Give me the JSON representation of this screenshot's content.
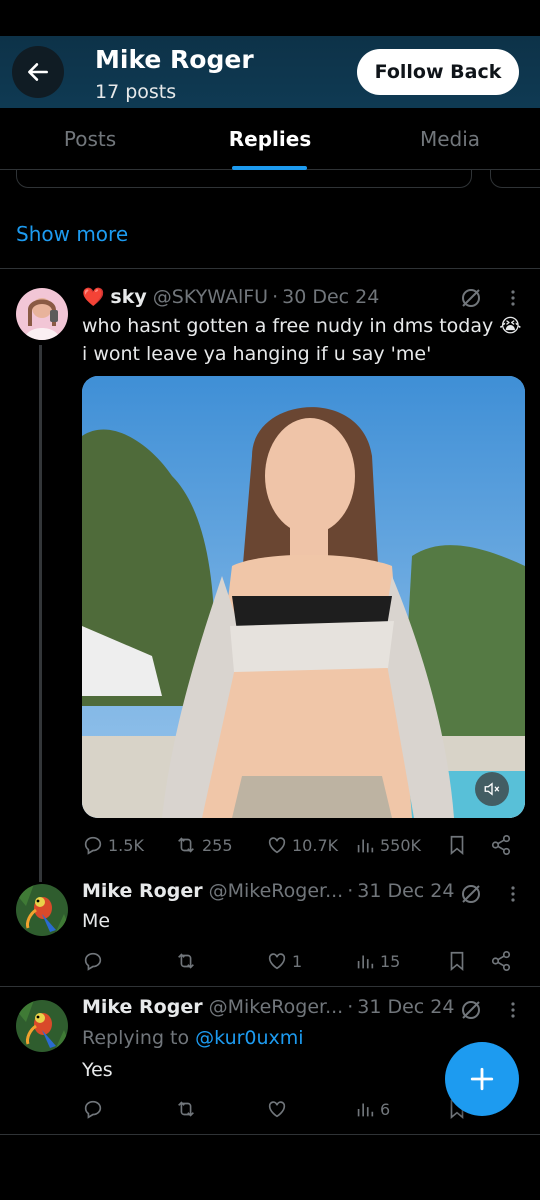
{
  "header": {
    "title": "Mike Roger",
    "post_count": "17 posts",
    "follow_label": "Follow Back"
  },
  "tabs": [
    {
      "label": "Posts"
    },
    {
      "label": "Replies",
      "active": true
    },
    {
      "label": "Media"
    }
  ],
  "show_more_label": "Show more",
  "tweets": [
    {
      "emoji": "❤️",
      "name": "sky",
      "handle": "@SKYWAlFU",
      "date": "30 Dec 24",
      "text_line1": "who hasnt gotten a free nudy in dms today 😭",
      "text_line2": "i wont leave ya hanging if u say 'me'",
      "stats": {
        "replies": "1.5K",
        "reposts": "255",
        "likes": "10.7K",
        "views": "550K"
      }
    },
    {
      "name": "Mike Roger",
      "handle": "@MikeRoger...",
      "date": "31 Dec 24",
      "text": "Me",
      "stats": {
        "replies": "",
        "reposts": "",
        "likes": "1",
        "views": "15"
      }
    },
    {
      "name": "Mike Roger",
      "handle": "@MikeRoger...",
      "date": "31 Dec 24",
      "replying_to_prefix": "Replying to ",
      "replying_to_handle": "@kur0uxmi",
      "text": "Yes",
      "stats": {
        "replies": "",
        "reposts": "",
        "likes": "",
        "views": "6"
      }
    }
  ],
  "icons": {
    "back": "arrow-left-icon",
    "grok": "grok-icon",
    "more": "more-vertical-icon",
    "reply": "reply-icon",
    "repost": "repost-icon",
    "like": "heart-icon",
    "views": "views-icon",
    "bookmark": "bookmark-icon",
    "share": "share-icon",
    "mute": "mute-icon",
    "compose": "plus-icon"
  },
  "colors": {
    "accent": "#1d9bf0",
    "header_bg": "#0f3a53",
    "text_secondary": "#71767b"
  }
}
